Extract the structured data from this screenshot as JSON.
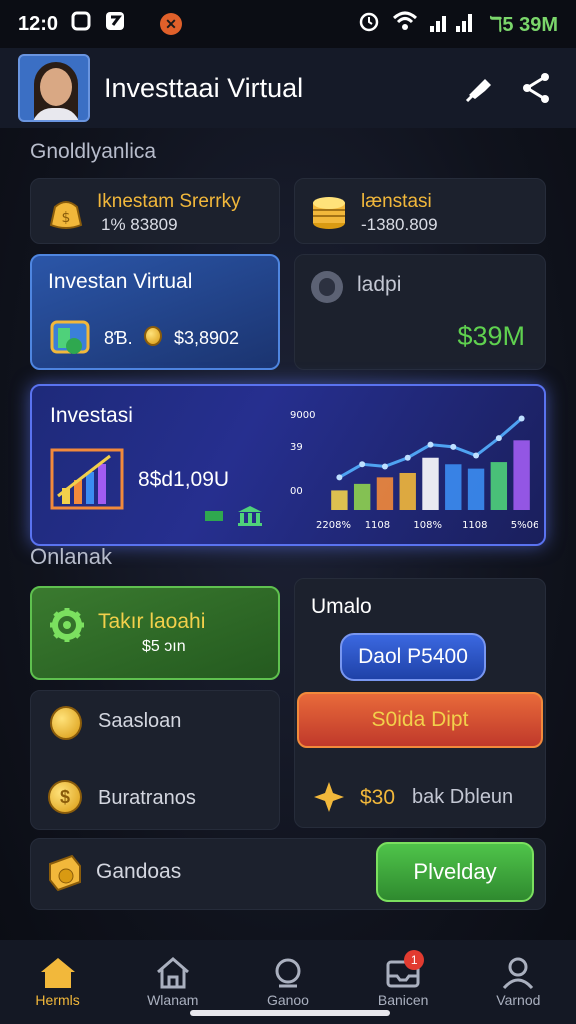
{
  "status_bar": {
    "time": "12:0",
    "right_text": "ℸ5 39M"
  },
  "header": {
    "title": "Investtaai Virtual"
  },
  "section1": {
    "title": "Gnoldlyanlica"
  },
  "card_sterky": {
    "title": "Iknestam Srerrky",
    "value": "1% 83809"
  },
  "card_lenstasi": {
    "title": "lænstasi",
    "value": "-1380.809"
  },
  "card_virtual": {
    "title": "Investan Virtual",
    "amount": "8Ɓ.",
    "value": "$3,8902"
  },
  "card_ladpi": {
    "title": "ladpi",
    "value": "$39M"
  },
  "invest_chart": {
    "title": "Investasi",
    "value": "8$d1,09U"
  },
  "chart_data": {
    "type": "bar",
    "x_tick_labels": [
      "2208%",
      "1108",
      "108%",
      "1108",
      "5%06"
    ],
    "y_tick_labels": [
      "9000",
      "39",
      "00"
    ],
    "values": [
      18,
      24,
      30,
      34,
      48,
      42,
      38,
      44,
      64
    ],
    "trend": [
      30,
      42,
      40,
      48,
      60,
      58,
      50,
      66,
      84
    ],
    "colors": [
      "#f2d04b",
      "#8fd14f",
      "#f28a3b",
      "#f2b83b",
      "#ffffff",
      "#3b8df2",
      "#3b8df2",
      "#4fd17a",
      "#a15cf2"
    ]
  },
  "section2": {
    "title": "Onlanak"
  },
  "card_takir": {
    "title": "Takır laoahi",
    "value": "$5 ɔın"
  },
  "card_umalo": {
    "title": "Umalo",
    "button": "Daol P5400"
  },
  "btn_soida": {
    "label": "S0ida Dipt"
  },
  "list_saoloan": {
    "label": "Saasloan"
  },
  "list_buratranos": {
    "label": "Buratranos"
  },
  "list_bak": {
    "amount": "$30",
    "label": "bak Dbleun"
  },
  "list_gandoas": {
    "label": "Gandoas"
  },
  "btn_plvelday": {
    "label": "Plvelday"
  },
  "nav": [
    {
      "label": "Hermls"
    },
    {
      "label": "Wlanam"
    },
    {
      "label": "Ganoo"
    },
    {
      "label": "Banicen",
      "badge": "1"
    },
    {
      "label": "Varnod"
    }
  ]
}
